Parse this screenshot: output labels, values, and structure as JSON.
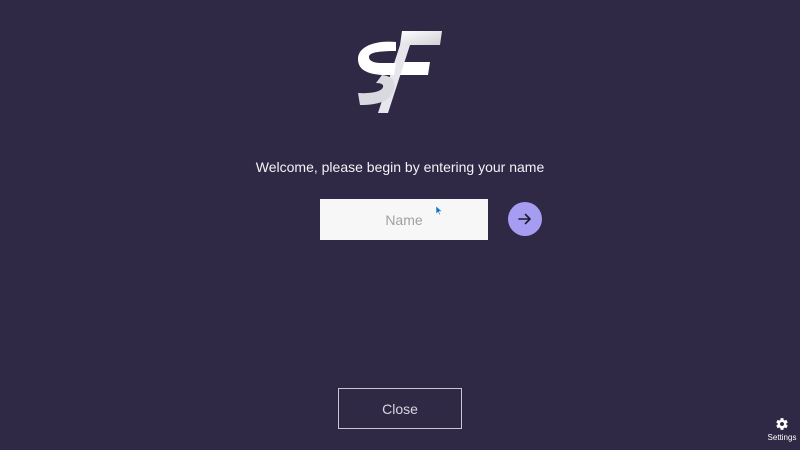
{
  "welcome": {
    "message": "Welcome, please begin by entering your name"
  },
  "name_field": {
    "placeholder": "Name",
    "value": ""
  },
  "submit": {
    "icon": "arrow-right-icon"
  },
  "close_button": {
    "label": "Close"
  },
  "settings": {
    "label": "Settings",
    "icon": "gear-icon"
  },
  "colors": {
    "background": "#2f2945",
    "accent": "#a69cf2",
    "input_background": "#f7f7f7"
  }
}
